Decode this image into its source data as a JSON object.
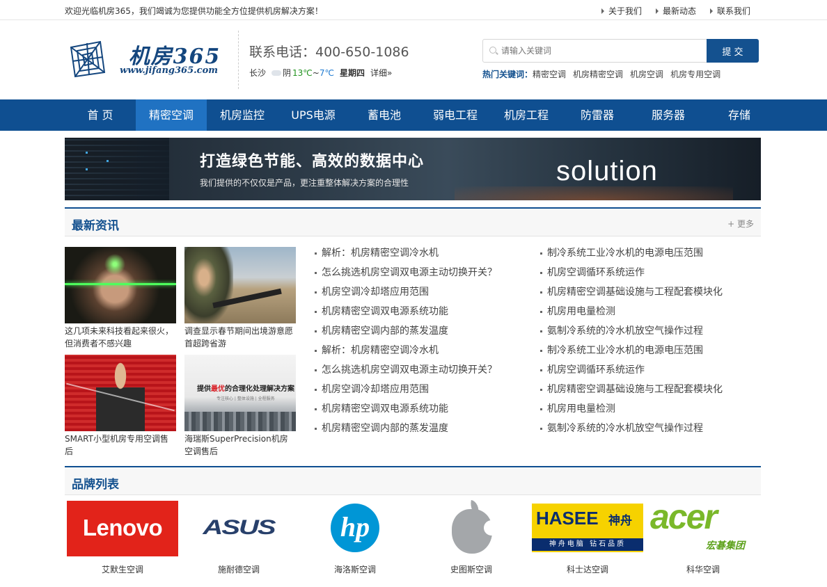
{
  "topbar": {
    "welcome": "欢迎光临机房365，我们竭诚为您提供功能全方位提供机房解决方案！",
    "links": [
      "关于我们",
      "最新动态",
      "联系我们"
    ]
  },
  "header": {
    "logo_text": "机房365",
    "logo_url": "www.jifang365.com",
    "phone": "联系电话：400-650-1086",
    "weather": {
      "city": "长沙",
      "condition": "阴",
      "temp_low": "13℃",
      "sep": "~",
      "temp_high": "7℃",
      "weekday": "星期四",
      "detail": "详细»"
    },
    "search": {
      "placeholder": "请输入关键词",
      "button": "提 交"
    },
    "hot": {
      "label": "热门关键词：",
      "keywords": [
        "精密空调",
        "机房精密空调",
        "机房空调",
        "机房专用空调"
      ]
    }
  },
  "nav": {
    "items": [
      "首 页",
      "精密空调",
      "机房监控",
      "UPS电源",
      "蓄电池",
      "弱电工程",
      "机房工程",
      "防雷器",
      "服务器",
      "存储"
    ],
    "active_index": 1
  },
  "banner": {
    "headline": "打造绿色节能、高效的数据中心",
    "subline": "我们提供的不仅仅是产品，更注重整体解决方案的合理性",
    "word": "solution"
  },
  "news_section": {
    "title": "最新资讯",
    "more": "+ 更多",
    "thumbs": [
      "这几项未来科技看起来很火，但消费者不感兴趣",
      "调查显示春节期间出境游意愿首超跨省游",
      "SMART小型机房专用空调售后",
      "海瑞斯SuperPrecision机房空调售后"
    ],
    "thumb4_title_pre": "提供",
    "thumb4_title_red": "最优",
    "thumb4_title_post": "的合理化处理解决方案",
    "thumb4_sub": "专注核心 | 整体设施 | 全程服务",
    "list_left": [
      "解析：机房精密空调冷水机",
      "怎么挑选机房空调双电源主动切换开关？",
      "机房空调冷却塔应用范围",
      "机房精密空调双电源系统功能",
      "机房精密空调内部的蒸发温度",
      "解析：机房精密空调冷水机",
      "怎么挑选机房空调双电源主动切换开关？",
      "机房空调冷却塔应用范围",
      "机房精密空调双电源系统功能",
      "机房精密空调内部的蒸发温度"
    ],
    "list_right": [
      "制冷系统工业冷水机的电源电压范围",
      "机房空调循环系统运作",
      "机房精密空调基础设施与工程配套模块化",
      "机房用电量检测",
      "氨制冷系统的冷水机放空气操作过程",
      "制冷系统工业冷水机的电源电压范围",
      "机房空调循环系统运作",
      "机房精密空调基础设施与工程配套模块化",
      "机房用电量检测",
      "氨制冷系统的冷水机放空气操作过程"
    ]
  },
  "brand_section": {
    "title": "品牌列表",
    "brands": [
      {
        "logo": "Lenovo",
        "name": "艾默生空调"
      },
      {
        "logo": "ASUS",
        "name": "施耐德空调"
      },
      {
        "logo": "hp",
        "name": "海洛斯空调"
      },
      {
        "logo": "apple-icon",
        "name": "史图斯空调"
      },
      {
        "logo": "HASEE",
        "logo_cn": "神舟",
        "logo_bar": "神舟电脑 钻石品质",
        "name": "科士达空调"
      },
      {
        "logo": "acer",
        "logo_cn": "宏碁集团",
        "name": "科华空调"
      }
    ]
  }
}
